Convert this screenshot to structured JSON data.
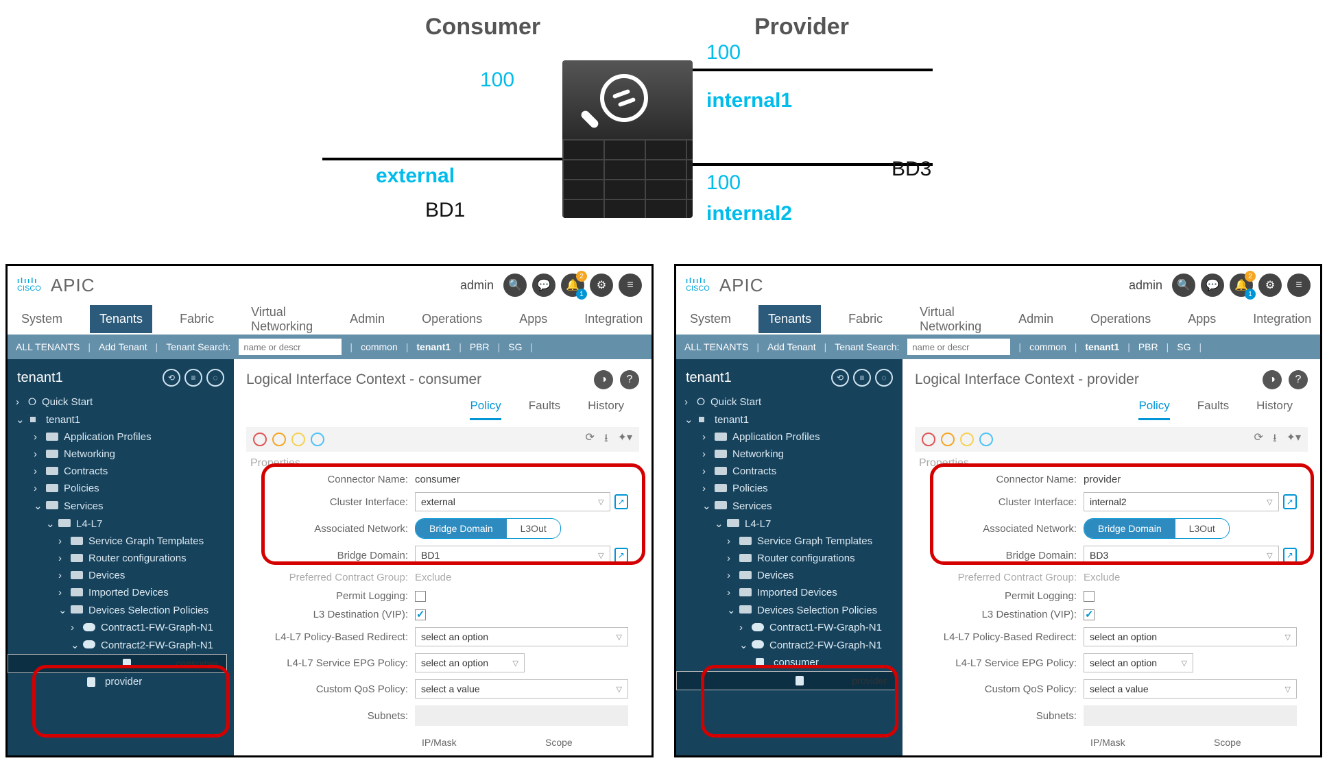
{
  "diagram": {
    "consumer_title": "Consumer",
    "provider_title": "Provider",
    "left_val": "100",
    "right_top_val": "100",
    "right_bot_val": "100",
    "left_if": "external",
    "right_if_top": "internal1",
    "right_if_bot": "internal2",
    "left_bd": "BD1",
    "right_bd": "BD3"
  },
  "header": {
    "product": "APIC",
    "user": "admin",
    "bell_top": "2",
    "bell_bot": "1"
  },
  "nav": {
    "items": [
      "System",
      "Tenants",
      "Fabric",
      "Virtual Networking",
      "Admin",
      "Operations",
      "Apps",
      "Integration"
    ],
    "active": "Tenants"
  },
  "subbar": {
    "all_tenants": "ALL TENANTS",
    "add_tenant": "Add Tenant",
    "search_label": "Tenant Search:",
    "search_placeholder": "name or descr",
    "crumbs": [
      "common",
      "tenant1",
      "PBR",
      "SG"
    ]
  },
  "side": {
    "title": "tenant1",
    "quick_start": "Quick Start",
    "root": "tenant1",
    "application_profiles": "Application Profiles",
    "networking": "Networking",
    "contracts": "Contracts",
    "policies": "Policies",
    "services": "Services",
    "l4l7": "L4-L7",
    "svc_graph_templates": "Service Graph Templates",
    "router_configs": "Router configurations",
    "devices": "Devices",
    "imported_devices": "Imported Devices",
    "dev_sel_policies": "Devices Selection Policies",
    "contract1": "Contract1-FW-Graph-N1",
    "contract2": "Contract2-FW-Graph-N1",
    "consumer": "consumer",
    "provider": "provider"
  },
  "left_panel": {
    "title": "Logical Interface Context - consumer",
    "tabs": [
      "Policy",
      "Faults",
      "History"
    ],
    "active_tab": "Policy",
    "properties_label": "Properties",
    "connector_name_label": "Connector Name:",
    "connector_name": "consumer",
    "cluster_if_label": "Cluster Interface:",
    "cluster_if": "external",
    "assoc_net_label": "Associated Network:",
    "seg_bd": "Bridge Domain",
    "seg_l3": "L3Out",
    "bd_label": "Bridge Domain:",
    "bd": "BD1",
    "pcg_label": "Preferred Contract Group:",
    "pcg": "Exclude",
    "permit_label": "Permit Logging:",
    "l3dest_label": "L3 Destination (VIP):",
    "pbr_label": "L4-L7 Policy-Based Redirect:",
    "pbr_ph": "select an option",
    "svcepg_label": "L4-L7 Service EPG Policy:",
    "svcepg_ph": "select an option",
    "qos_label": "Custom QoS Policy:",
    "qos_ph": "select a value",
    "subnets_label": "Subnets:",
    "col_ip": "IP/Mask",
    "col_scope": "Scope"
  },
  "right_panel": {
    "title": "Logical Interface Context - provider",
    "tabs": [
      "Policy",
      "Faults",
      "History"
    ],
    "active_tab": "Policy",
    "properties_label": "Properties",
    "connector_name_label": "Connector Name:",
    "connector_name": "provider",
    "cluster_if_label": "Cluster Interface:",
    "cluster_if": "internal2",
    "assoc_net_label": "Associated Network:",
    "seg_bd": "Bridge Domain",
    "seg_l3": "L3Out",
    "bd_label": "Bridge Domain:",
    "bd": "BD3",
    "pcg_label": "Preferred Contract Group:",
    "pcg": "Exclude",
    "permit_label": "Permit Logging:",
    "l3dest_label": "L3 Destination (VIP):",
    "pbr_label": "L4-L7 Policy-Based Redirect:",
    "pbr_ph": "select an option",
    "svcepg_label": "L4-L7 Service EPG Policy:",
    "svcepg_ph": "select an option",
    "qos_label": "Custom QoS Policy:",
    "qos_ph": "select a value",
    "subnets_label": "Subnets:",
    "col_ip": "IP/Mask",
    "col_scope": "Scope"
  }
}
